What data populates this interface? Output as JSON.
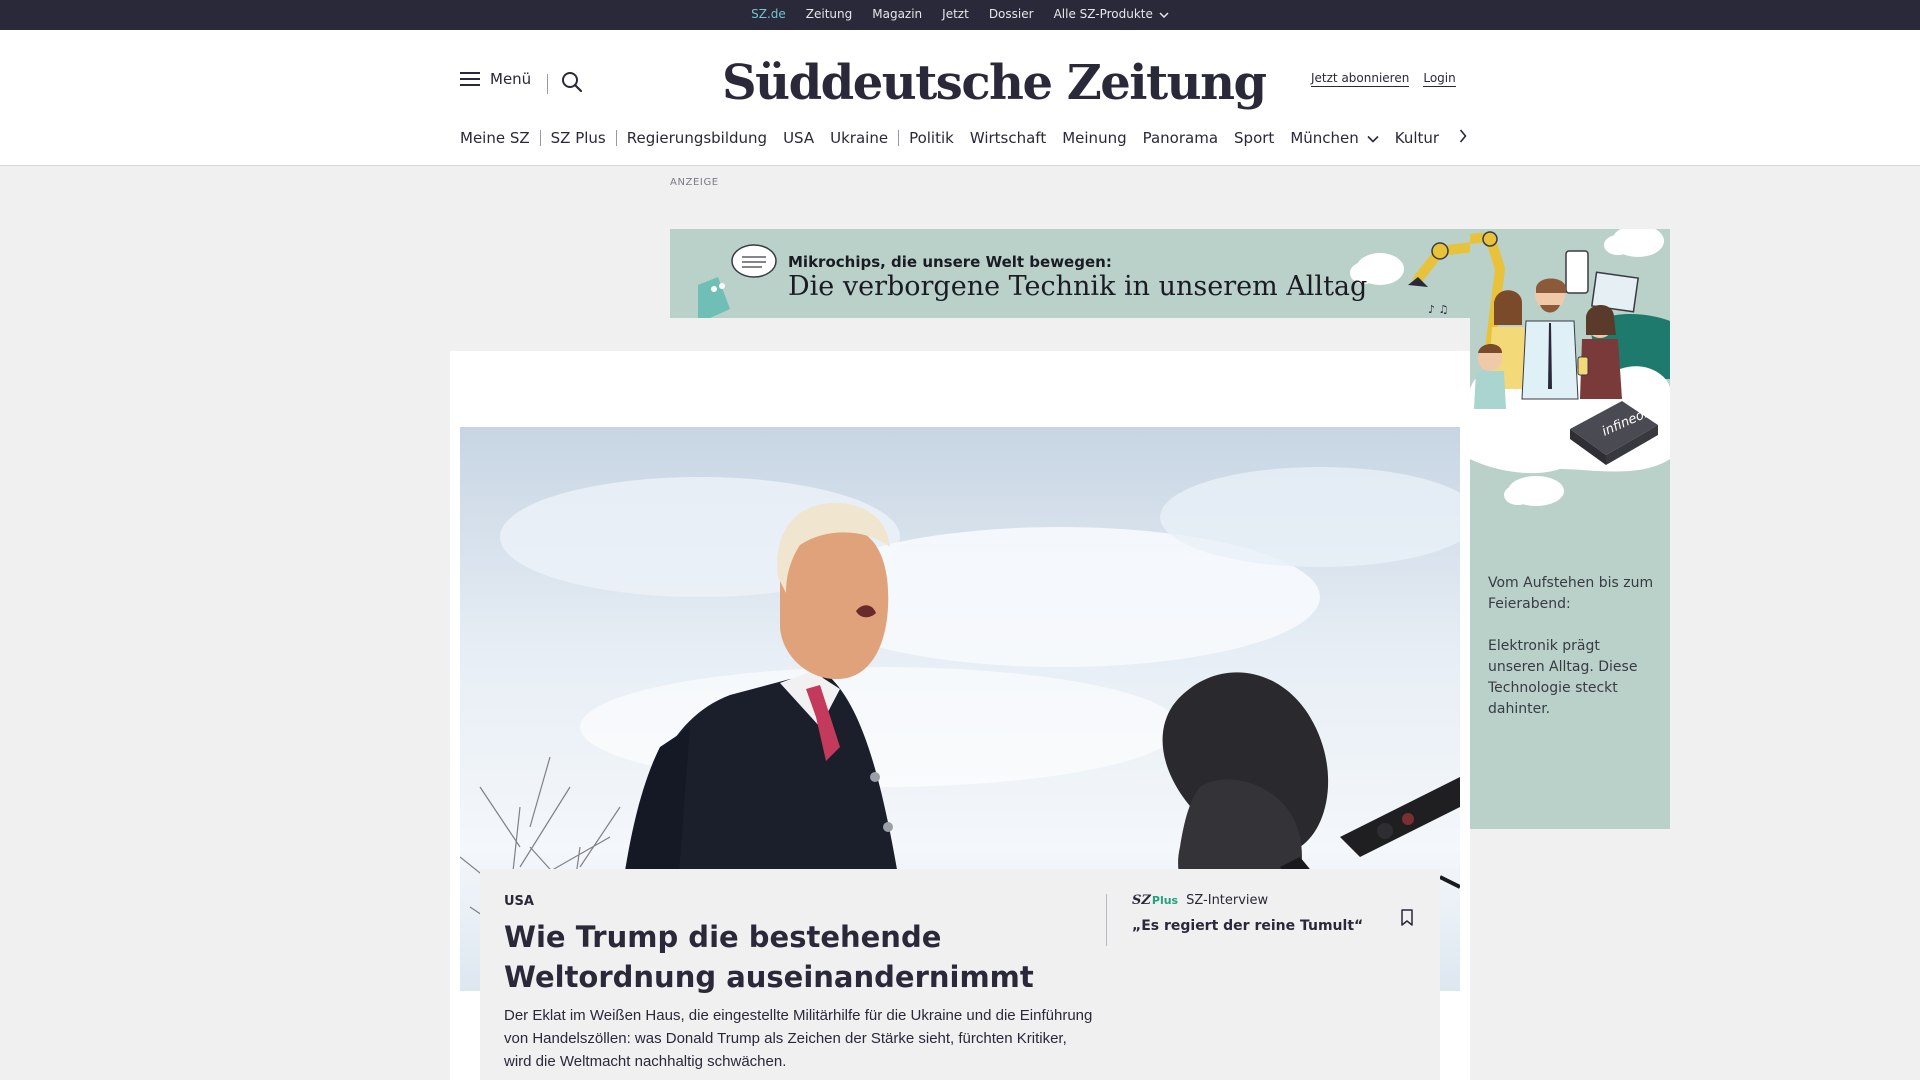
{
  "topbar": {
    "links": [
      "SZ.de",
      "Zeitung",
      "Magazin",
      "Jetzt",
      "Dossier"
    ],
    "products_label": "Alle SZ-Produkte"
  },
  "header": {
    "menu_label": "Menü",
    "logo_text": "Süddeutsche Zeitung",
    "subscribe_label": "Jetzt abonnieren",
    "login_label": "Login"
  },
  "nav": {
    "items": [
      "Meine SZ",
      "SZ Plus",
      "Regierungsbildung",
      "USA",
      "Ukraine",
      "Politik",
      "Wirtschaft",
      "Meinung",
      "Panorama",
      "Sport",
      "München",
      "Kultur"
    ]
  },
  "ad": {
    "label": "ANZEIGE",
    "kicker": "Mikrochips, die unsere Welt bewegen:",
    "headline": "Die verborgene Technik in unserem Alltag",
    "brand": "infineon",
    "side_text_1": "Vom Aufstehen bis zum Feierabend:",
    "side_text_2": "Elektronik prägt unseren Alltag. Diese Technologie steckt dahinter."
  },
  "lead": {
    "kicker": "USA",
    "headline": "Wie Trump die bestehende Weltordnung auseinandernimmt",
    "summary": "Der Eklat im Weißen Haus, die eingestellte Militärhilfe für die Ukraine und die Einführung von Handelszöllen: was Donald Trump als Zeichen der Stärke sieht, fürchten Kritiker, wird die Weltmacht nachhaltig schwächen."
  },
  "related": {
    "badge_sz": "SZ",
    "badge_plus": "Plus",
    "kicker": "SZ-Interview",
    "title": "„Es regiert der reine Tumult“"
  },
  "colors": {
    "topbar_bg": "#29293a",
    "topbar_active": "#71c3cc",
    "ad_bg": "#b9d1c8",
    "plus_green": "#21a27e"
  },
  "icons": [
    "hamburger-icon",
    "search-icon",
    "chevron-down-icon",
    "chevron-right-icon",
    "bookmark-icon"
  ]
}
